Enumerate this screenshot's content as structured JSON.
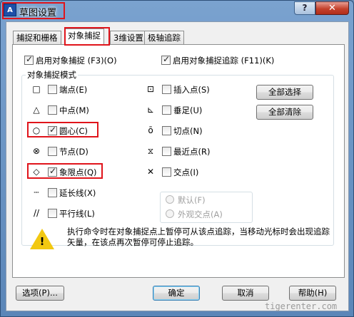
{
  "window": {
    "title": "草图设置",
    "app_icon": "A",
    "help_glyph": "?",
    "close_glyph": "✕"
  },
  "tabs": [
    {
      "label": "捕捉和栅格"
    },
    {
      "label": "对象捕捉",
      "active": true
    },
    {
      "label": "3维设置"
    },
    {
      "label": "极轴追踪"
    }
  ],
  "panel": {
    "enable_osnap": {
      "label": "启用对象捕捉 (F3)(O)",
      "checked": true
    },
    "enable_tracking": {
      "label": "启用对象捕捉追踪 (F11)(K)",
      "checked": true
    },
    "group_title": "对象捕捉模式",
    "left_modes": [
      {
        "symbol": "square-icon",
        "glyph": "□",
        "label": "端点(E)",
        "checked": false
      },
      {
        "symbol": "triangle-icon",
        "glyph": "△",
        "label": "中点(M)",
        "checked": false
      },
      {
        "symbol": "circle-icon",
        "glyph": "○",
        "label": "圆心(C)",
        "checked": true
      },
      {
        "symbol": "node-icon",
        "glyph": "⊗",
        "label": "节点(D)",
        "checked": false
      },
      {
        "symbol": "diamond-icon",
        "glyph": "◇",
        "label": "象限点(Q)",
        "checked": true
      },
      {
        "symbol": "extension-icon",
        "glyph": "┄",
        "label": "延长线(X)",
        "checked": false
      },
      {
        "symbol": "parallel-icon",
        "glyph": "//",
        "label": "平行线(L)",
        "checked": false
      }
    ],
    "right_modes": [
      {
        "symbol": "insertion-icon",
        "glyph": "⊡",
        "label": "插入点(S)",
        "checked": false
      },
      {
        "symbol": "perpendicular-icon",
        "glyph": "⊾",
        "label": "垂足(U)",
        "checked": false
      },
      {
        "symbol": "tangent-icon",
        "glyph": "ō",
        "label": "切点(N)",
        "checked": false
      },
      {
        "symbol": "nearest-icon",
        "glyph": "⧖",
        "label": "最近点(R)",
        "checked": false
      },
      {
        "symbol": "intersection-icon",
        "glyph": "✕",
        "label": "交点(I)",
        "checked": false
      }
    ],
    "select_all": "全部选择",
    "clear_all": "全部清除",
    "radio_default": "默认(F)",
    "radio_apparent": "外观交点(A)",
    "message": "执行命令时在对象捕捉点上暂停可从该点追踪，当移动光标时会出现追踪矢量，在该点再次暂停可停止追踪。"
  },
  "footer": {
    "options": "选项(P)...",
    "ok": "确定",
    "cancel": "取消",
    "help": "帮助(H)"
  },
  "watermark": "tigerenter.com"
}
